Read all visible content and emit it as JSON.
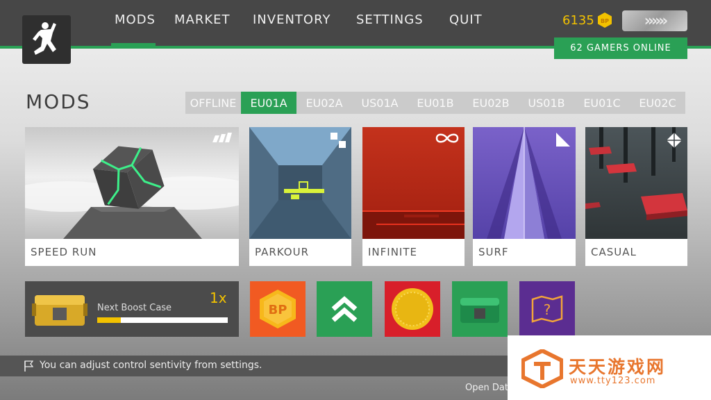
{
  "nav": {
    "items": [
      "MODS",
      "MARKET",
      "INVENTORY",
      "SETTINGS",
      "QUIT"
    ],
    "active": "MODS"
  },
  "currency": {
    "bp": "6135",
    "coin_label": "BP"
  },
  "rank_symbol": "»»»",
  "online": "62 GAMERS ONLINE",
  "page_title": "MODS",
  "servers": [
    "OFFLINE",
    "EU01A",
    "EU02A",
    "US01A",
    "EU01B",
    "EU02B",
    "US01B",
    "EU01C",
    "EU02C"
  ],
  "active_server": "EU01A",
  "modes": [
    {
      "label": "SPEED RUN",
      "icon": "bars-icon"
    },
    {
      "label": "PARKOUR",
      "icon": "squares-icon"
    },
    {
      "label": "INFINITE",
      "icon": "infinity-icon"
    },
    {
      "label": "SURF",
      "icon": "triangle-icon"
    },
    {
      "label": "CASUAL",
      "icon": "diamonds-icon"
    }
  ],
  "boost": {
    "label": "Next Boost Case",
    "multiplier": "1x",
    "progress": 0.18
  },
  "tiles": [
    {
      "name": "bp-tile",
      "color": "#f15a22"
    },
    {
      "name": "rank-up-tile",
      "color": "#2aa055"
    },
    {
      "name": "coin-tile",
      "color": "#d81f2a"
    },
    {
      "name": "case-tile",
      "color": "#2aa055"
    },
    {
      "name": "map-tile",
      "color": "#5b2d91"
    }
  ],
  "tip": "You can adjust control sentivity from settings.",
  "open_data": "Open Data",
  "watermark": {
    "title": "天天游戏网",
    "url": "www.tty123.com"
  }
}
